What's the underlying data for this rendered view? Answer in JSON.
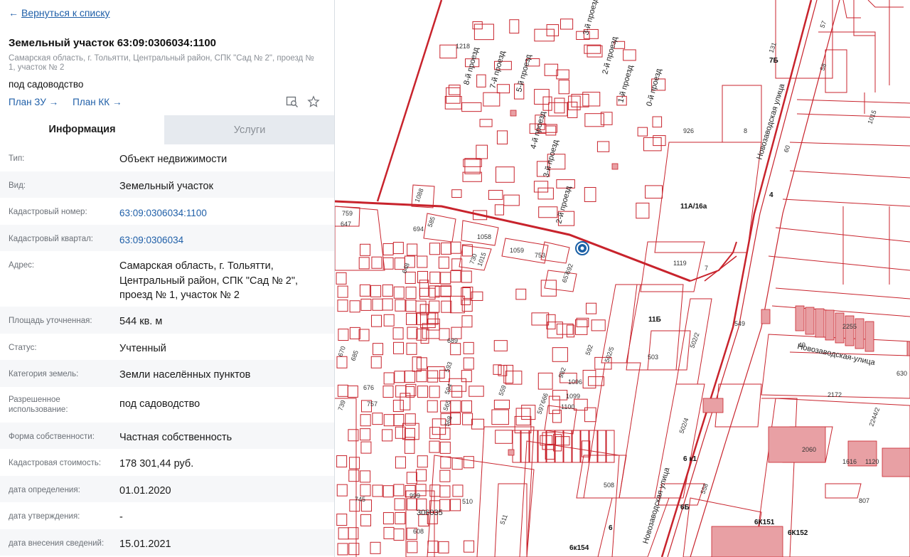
{
  "header": {
    "back_label": "Вернуться к списку",
    "title": "Земельный участок 63:09:0306034:1100",
    "address_small": "Самарская область, г. Тольятти, Центральный район, СПК \"Сад № 2\", проезд № 1, участок № 2",
    "purpose": "под садоводство",
    "link_plan_zu": "План ЗУ",
    "link_plan_kk": "План КК"
  },
  "tabs": [
    {
      "label": "Информация",
      "active": true
    },
    {
      "label": "Услуги",
      "active": false
    }
  ],
  "info_rows": [
    {
      "key": "Тип:",
      "value": "Объект недвижимости"
    },
    {
      "key": "Вид:",
      "value": "Земельный участок"
    },
    {
      "key": "Кадастровый номер:",
      "value": "63:09:0306034:1100"
    },
    {
      "key": "Кадастровый квартал:",
      "value": "63:09:0306034"
    },
    {
      "key": "Адрес:",
      "value": "Самарская область, г. Тольятти, Центральный район, СПК \"Сад № 2\", проезд № 1, участок № 2"
    },
    {
      "key": "Площадь уточненная:",
      "value": "544 кв. м"
    },
    {
      "key": "Статус:",
      "value": "Учтенный"
    },
    {
      "key": "Категория земель:",
      "value": "Земли населённых пунктов"
    },
    {
      "key": "Разрешенное использование:",
      "value": "под садоводство"
    },
    {
      "key": "Форма собственности:",
      "value": "Частная собственность"
    },
    {
      "key": "Кадастровая стоимость:",
      "value": "178 301,44 руб."
    },
    {
      "key": "дата определения:",
      "value": "01.01.2020"
    },
    {
      "key": "дата утверждения:",
      "value": "-"
    },
    {
      "key": "дата внесения сведений:",
      "value": "15.01.2021"
    }
  ],
  "map": {
    "streets": [
      "Новозаводская улица",
      "Новозаводская-улица",
      "Новозаводская улица"
    ],
    "drives": [
      "8-й проезд",
      "7-й проезд",
      "5-й проезд",
      "4-й проезд",
      "3-й проезд",
      "3-й проезд",
      "2-й проезд",
      "2-й проезд",
      "1-й проезд",
      "0-й проезд"
    ],
    "labels_bold": [
      "11А/16а",
      "11Б",
      "7Б",
      "4",
      "6 к1",
      "6Б",
      "6",
      "6К151",
      "6К152",
      "6к154"
    ],
    "labels_parcels": [
      "1218",
      "1088",
      "759",
      "647",
      "694",
      "585",
      "1058",
      "1059",
      "753",
      "692",
      "657",
      "730",
      "1015",
      "648",
      "689",
      "670",
      "685",
      "676",
      "739",
      "757",
      "593",
      "594",
      "565",
      "568",
      "559",
      "592",
      "982",
      "1096",
      "1099",
      "1100",
      "666",
      "597",
      "999",
      "745",
      "608",
      "510",
      "511",
      "508",
      "502/5",
      "503",
      "502/2",
      "502/4",
      "558",
      "926",
      "8",
      "60",
      "58",
      "57",
      "131",
      "1015",
      "549",
      "2255",
      "49",
      "630",
      "2172",
      "2244/2",
      "2060",
      "1616",
      "1120",
      "807",
      "1119",
      "7",
      "2"
    ],
    "block_label": "306035",
    "colors": {
      "line": "#c8232c",
      "fill": "#e8a0a4",
      "marker": "#1a5fa5"
    }
  }
}
